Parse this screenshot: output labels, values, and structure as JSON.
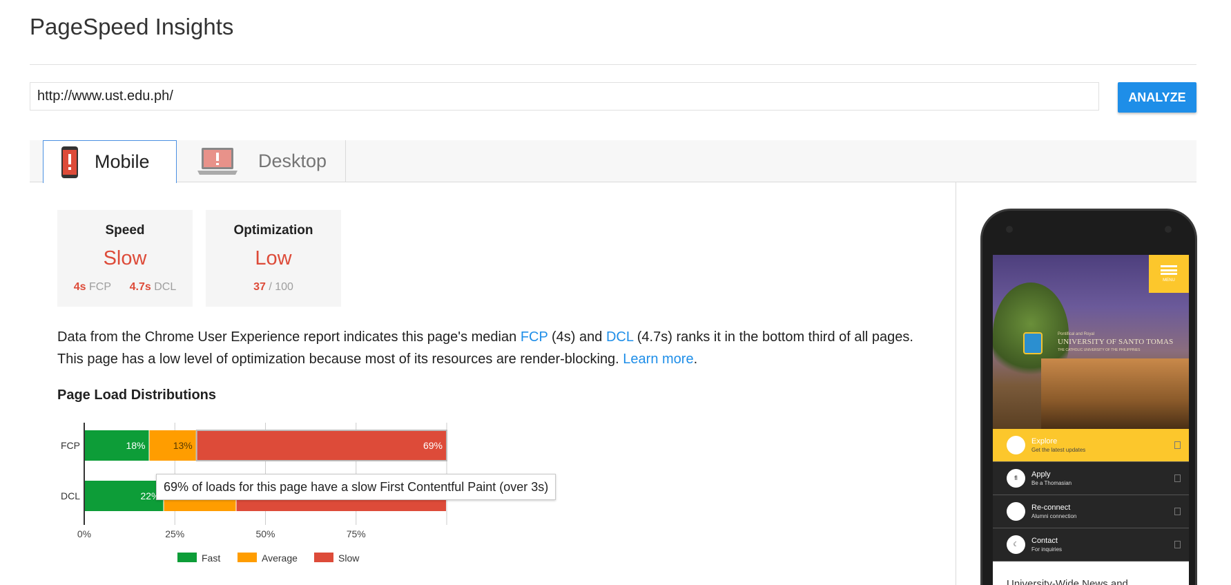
{
  "page": {
    "title": "PageSpeed Insights"
  },
  "search": {
    "url_value": "http://www.ust.edu.ph/",
    "analyze_label": "ANALYZE"
  },
  "tabs": [
    {
      "label": "Mobile",
      "icon": "mobile-warning-icon",
      "active": true
    },
    {
      "label": "Desktop",
      "icon": "desktop-warning-icon",
      "active": false
    }
  ],
  "cards": {
    "speed": {
      "title": "Speed",
      "value": "Slow",
      "fcp_value": "4s",
      "fcp_label": "FCP",
      "dcl_value": "4.7s",
      "dcl_label": "DCL"
    },
    "optimization": {
      "title": "Optimization",
      "value": "Low",
      "score": "37",
      "score_suffix": "/ 100"
    }
  },
  "summary": {
    "line1_a": "Data from the Chrome User Experience report indicates this page's median ",
    "fcp_link": "FCP",
    "line1_b": " (4s) and ",
    "dcl_link": "DCL",
    "line1_c": " (4.7s) ranks it in the bottom third of all pages.",
    "line2": "This page has a low level of optimization because most of its resources are render-blocking. ",
    "learn_more": "Learn more",
    "period": "."
  },
  "distributions": {
    "title": "Page Load Distributions"
  },
  "chart_data": {
    "type": "bar",
    "orientation": "horizontal",
    "stacked": true,
    "categories": [
      "FCP",
      "DCL"
    ],
    "series": [
      {
        "name": "Fast",
        "values": [
          18,
          22
        ],
        "color": "#0d9d38"
      },
      {
        "name": "Average",
        "values": [
          13,
          20
        ],
        "color": "#ff9d00"
      },
      {
        "name": "Slow",
        "values": [
          69,
          58
        ],
        "color": "#dd4b39"
      }
    ],
    "data_labels": [
      [
        "18%",
        "13%",
        "69%"
      ],
      [
        "22%",
        "",
        ""
      ]
    ],
    "x_ticks": [
      "0%",
      "25%",
      "50%",
      "75%"
    ],
    "xlim": [
      0,
      100
    ],
    "legend": "bottom",
    "tooltip": "69% of loads for this page have a slow First Contentful Paint (over 3s)"
  },
  "phone": {
    "hero_small": "Pontifical and Royal",
    "hero_title": "UNIVERSITY OF SANTO TOMAS",
    "hero_sub": "THE CATHOLIC UNIVERSITY OF THE PHILIPPINES",
    "menu_label": "MENU",
    "rows": [
      {
        "title": "Explore",
        "subtitle": "Get the latest updates",
        "icon": "explore-icon",
        "active": true
      },
      {
        "title": "Apply",
        "subtitle": "Be a Thomasian",
        "icon": "apply-icon",
        "active": false
      },
      {
        "title": "Re-connect",
        "subtitle": "Alumni connection",
        "icon": "reconnect-icon",
        "active": false
      },
      {
        "title": "Contact",
        "subtitle": "For inquiries",
        "icon": "contact-icon",
        "active": false
      }
    ],
    "news": "University-Wide News and"
  }
}
